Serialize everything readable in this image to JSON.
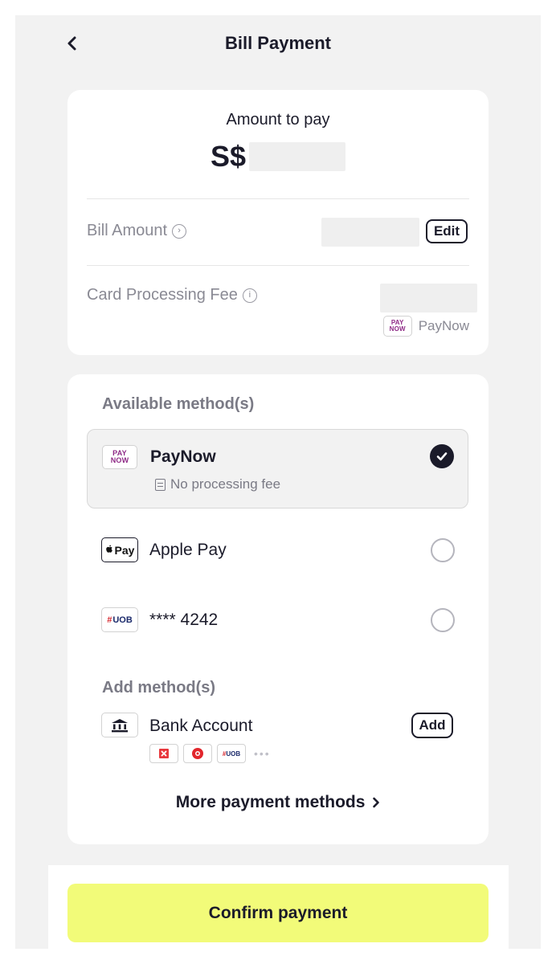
{
  "header": {
    "title": "Bill Payment",
    "back_icon": "chevron-left-icon"
  },
  "amount": {
    "label": "Amount to pay",
    "currency": "S$"
  },
  "bill_amount": {
    "label": "Bill Amount",
    "edit_label": "Edit"
  },
  "processing_fee": {
    "label": "Card Processing Fee",
    "method_label": "PayNow"
  },
  "available": {
    "title": "Available method(s)",
    "methods": [
      {
        "name": "PayNow",
        "note": "No processing fee",
        "selected": true,
        "logo": "paynow-logo"
      },
      {
        "name": "Apple Pay",
        "selected": false,
        "logo": "apple-pay-logo"
      },
      {
        "name": "**** 4242",
        "selected": false,
        "logo": "uob-logo"
      }
    ]
  },
  "add_methods": {
    "title": "Add method(s)",
    "bank_account_label": "Bank Account",
    "add_label": "Add"
  },
  "logos": {
    "paynow_top": "PAY",
    "paynow_bottom": "NOW",
    "apple_pay": "Pay",
    "uob": "UOB"
  },
  "more_methods_label": "More payment methods",
  "confirm_label": "Confirm payment",
  "colors": {
    "accent": "#f2fb79",
    "text_dark": "#1b1b2a",
    "text_muted": "#8a8a94",
    "paynow": "#8e2a86"
  }
}
